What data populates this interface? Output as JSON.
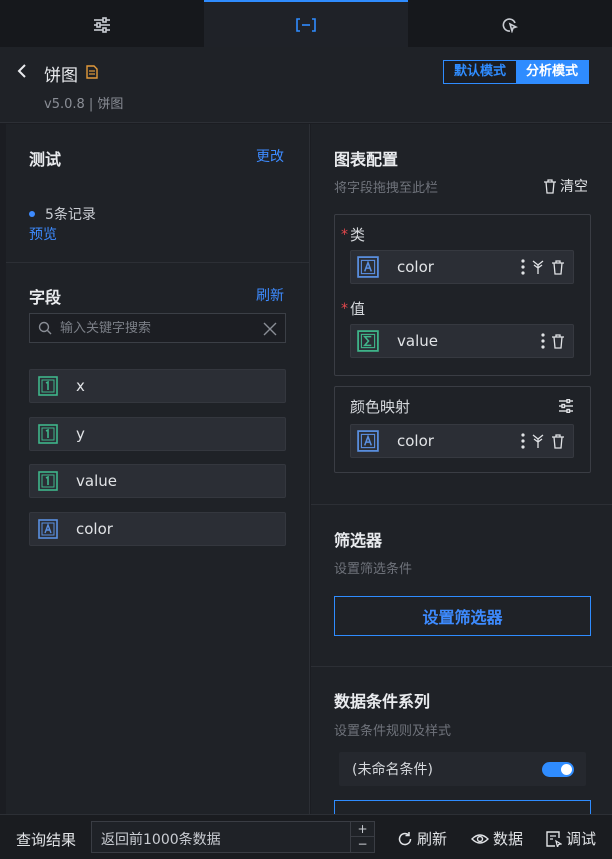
{
  "header": {
    "title": "饼图",
    "version": "v5.0.8 | 饼图",
    "modes": {
      "default": "默认模式",
      "analysis": "分析模式"
    }
  },
  "test": {
    "title": "测试",
    "change": "更改",
    "records": "5条记录",
    "preview": "预览"
  },
  "fields": {
    "title": "字段",
    "refresh": "刷新",
    "search_placeholder": "输入关键字搜索",
    "items": [
      {
        "name": "x",
        "type": "number"
      },
      {
        "name": "y",
        "type": "number"
      },
      {
        "name": "value",
        "type": "number"
      },
      {
        "name": "color",
        "type": "text"
      }
    ]
  },
  "chart_config": {
    "title": "图表配置",
    "hint": "将字段拖拽至此栏",
    "clear": "清空",
    "category_label": "类",
    "category_field": "color",
    "value_label": "值",
    "value_field": "value",
    "color_label": "颜色映射",
    "color_field": "color"
  },
  "filter": {
    "title": "筛选器",
    "hint": "设置筛选条件",
    "button": "设置筛选器"
  },
  "conditions": {
    "title": "数据条件系列",
    "hint": "设置条件规则及样式",
    "item": "(未命名条件)",
    "enabled": true
  },
  "bottom": {
    "label": "查询结果",
    "query_value": "返回前1000条数据",
    "refresh": "刷新",
    "data": "数据",
    "debug": "调试"
  },
  "colors": {
    "accent": "#2f8cff",
    "required": "#e5484d",
    "doc_icon": "#e39a3b",
    "number_icon": "#3fb58a",
    "text_icon": "#5a8fe0"
  }
}
